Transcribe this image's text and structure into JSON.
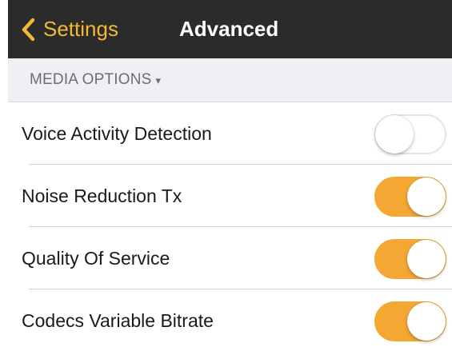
{
  "navbar": {
    "back_label": "Settings",
    "title": "Advanced",
    "back_icon": "chevron-left-icon"
  },
  "section": {
    "title": "MEDIA OPTIONS",
    "caret": "▾"
  },
  "settings": [
    {
      "label": "Voice Activity Detection",
      "enabled": false
    },
    {
      "label": "Noise Reduction Tx",
      "enabled": true
    },
    {
      "label": "Quality Of Service",
      "enabled": true
    },
    {
      "label": "Codecs Variable Bitrate",
      "enabled": true
    }
  ],
  "colors": {
    "accent": "#f5b833",
    "toggle_on": "#f5a733",
    "navbar_bg": "#2b2b2b",
    "section_bg": "#efeff4"
  }
}
